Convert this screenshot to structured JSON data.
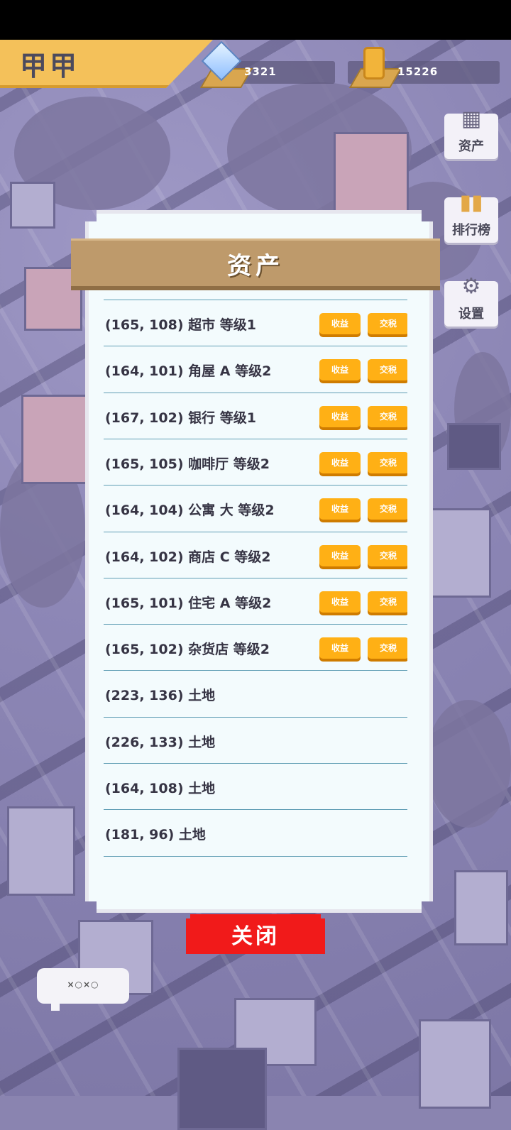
{
  "player": {
    "name": "甲甲"
  },
  "resources": {
    "diamonds": {
      "icon": "diamond-icon",
      "value": "3321"
    },
    "coins": {
      "icon": "coin-icon",
      "value": "15226"
    }
  },
  "side_menu": {
    "assets": {
      "label": "资产",
      "icon": "buildings-icon"
    },
    "ranking": {
      "label": "排行榜",
      "icon": "chart-bars-icon"
    },
    "settings": {
      "label": "设置",
      "icon": "gear-icon"
    }
  },
  "assets_panel": {
    "title": "资产",
    "rows": [
      {
        "text": "(165, 108) 超市 等级1",
        "income_label": "收益",
        "sell_label": "交税",
        "has_actions": true
      },
      {
        "text": "(164, 101) 角屋 A 等级2",
        "income_label": "收益",
        "sell_label": "交税",
        "has_actions": true
      },
      {
        "text": "(167, 102) 银行 等级1",
        "income_label": "收益",
        "sell_label": "交税",
        "has_actions": true
      },
      {
        "text": "(165, 105) 咖啡厅 等级2",
        "income_label": "收益",
        "sell_label": "交税",
        "has_actions": true
      },
      {
        "text": "(164, 104) 公寓 大 等级2",
        "income_label": "收益",
        "sell_label": "交税",
        "has_actions": true
      },
      {
        "text": "(164, 102) 商店 C 等级2",
        "income_label": "收益",
        "sell_label": "交税",
        "has_actions": true
      },
      {
        "text": "(165, 101) 住宅 A 等级2",
        "income_label": "收益",
        "sell_label": "交税",
        "has_actions": true
      },
      {
        "text": "(165, 102) 杂货店 等级2",
        "income_label": "收益",
        "sell_label": "交税",
        "has_actions": true
      },
      {
        "text": "(223, 136) 土地",
        "has_actions": false
      },
      {
        "text": "(226, 133) 土地",
        "has_actions": false
      },
      {
        "text": "(164, 108) 土地",
        "has_actions": false
      },
      {
        "text": "(181, 96) 土地",
        "has_actions": false
      },
      {
        "text": "",
        "has_actions": false
      }
    ],
    "close_label": "关闭"
  },
  "chat": {
    "text": "×○×○"
  }
}
